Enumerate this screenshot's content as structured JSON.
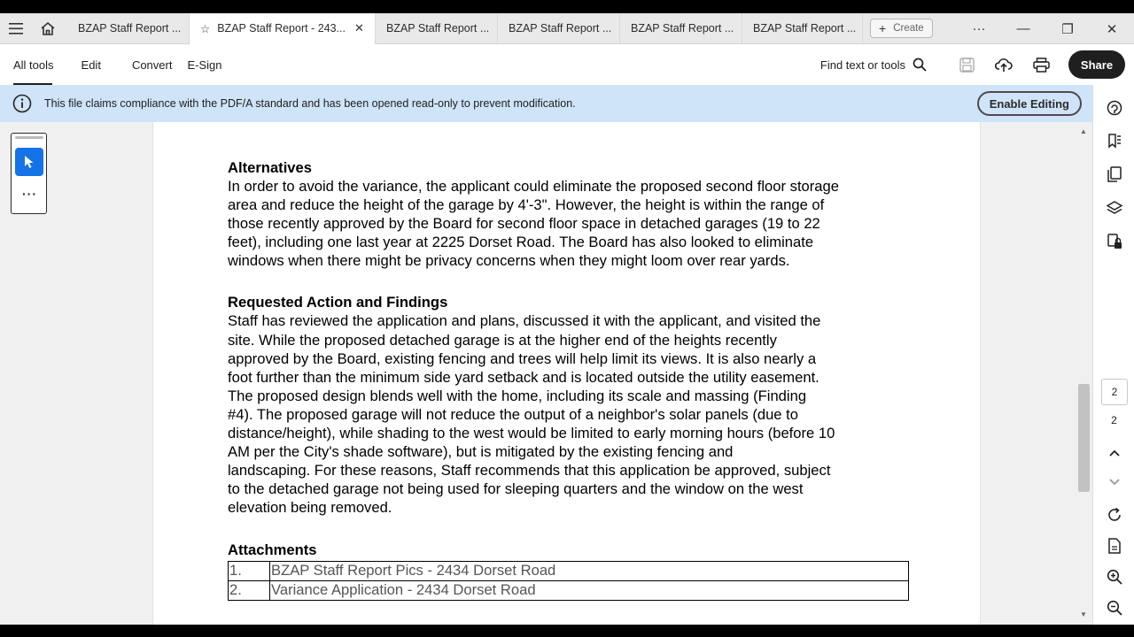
{
  "tabs": [
    {
      "label": "BZAP Staff Report ...",
      "active": false
    },
    {
      "label": "BZAP Staff Report - 243...",
      "active": true
    },
    {
      "label": "BZAP Staff Report ...",
      "active": false
    },
    {
      "label": "BZAP Staff Report ...",
      "active": false
    },
    {
      "label": "BZAP Staff Report ...",
      "active": false
    },
    {
      "label": "BZAP Staff Report ...",
      "active": false
    }
  ],
  "create_label": "Create",
  "toolbar": {
    "menu": [
      "All tools",
      "Edit",
      "Convert",
      "E-Sign"
    ],
    "find_label": "Find text or tools",
    "share_label": "Share"
  },
  "banner": {
    "message": "This file claims compliance with the PDF/A standard and has been opened read-only to prevent modification.",
    "button": "Enable Editing"
  },
  "document": {
    "alternatives_heading": "Alternatives",
    "alternatives_text": "In order to avoid the variance, the applicant could eliminate the proposed second floor storage\narea and reduce the height of the garage by 4'-3\".  However, the height is within the range of\nthose recently approved by the Board for second floor space in detached garages (19 to 22\nfeet), including one last year at 2225 Dorset Road. The Board has also looked to eliminate\nwindows when there might be privacy concerns when they might loom over rear yards.",
    "findings_heading": "Requested Action and Findings",
    "findings_text": " Staff has reviewed the application and plans, discussed it with the applicant, and visited the\nsite.  While the proposed detached garage is at the higher end of the heights recently\napproved by the Board, existing fencing and trees will help limit its views.  It is also nearly a\nfoot further than the minimum side yard setback and is located outside the utility easement.\nThe proposed design blends well with the home, including its scale and massing (Finding\n#4).  The proposed garage will not reduce the output of a neighbor's solar panels (due to\ndistance/height), while shading to the west would be limited to early morning hours (before 10\nAM per the City's shade software), but is mitigated by the existing fencing and\nlandscaping.  For these reasons, Staff recommends that this application be approved, subject\nto the detached garage not being used for sleeping quarters and the window on the west\nelevation being removed.",
    "attachments_heading": "Attachments",
    "attachments": [
      {
        "num": "1.",
        "title": "BZAP Staff Report Pics - 2434 Dorset Road"
      },
      {
        "num": "2.",
        "title": "Variance Application - 2434 Dorset Road"
      }
    ]
  },
  "pager": {
    "current": "2",
    "total": "2"
  },
  "colors": {
    "accent": "#1473e6",
    "banner": "#cfe4f8",
    "share": "#1f1f1f"
  }
}
